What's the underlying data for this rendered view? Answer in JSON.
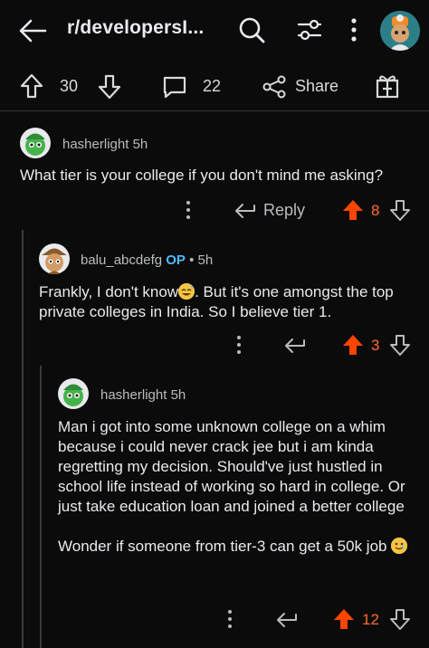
{
  "header": {
    "subreddit_title": "r/developersI...",
    "icons": [
      "back-arrow-icon",
      "search-icon",
      "sort-filter-icon",
      "more-vertical-icon",
      "subreddit-avatar-icon"
    ]
  },
  "post_actions": {
    "upvotes": "30",
    "comments": "22",
    "share_label": "Share"
  },
  "comments": [
    {
      "username": "hasherlight",
      "op_badge": "",
      "time": "5h",
      "body": [
        "What tier is your college if you don't mind me asking?"
      ],
      "reply_label": "Reply",
      "votes": "8"
    },
    {
      "username": "balu_abcdefg",
      "op_badge": "OP",
      "time": "5h",
      "body_prefix": "Frankly, I don't know",
      "body_suffix": ". But it's one amongst the top private colleges in India. So I believe tier 1.",
      "emoji": "sweat-smile-emoji",
      "votes": "3"
    },
    {
      "username": "hasherlight",
      "op_badge": "",
      "time": "5h",
      "body": [
        "Man i got into some unknown college on a whim because i could never crack jee but i am kinda regretting my decision. Should've just hustled in school life instead of working so hard in college. Or just take education loan and joined a better college"
      ],
      "body2_prefix": "Wonder if someone from tier-3 can get a 50k job",
      "emoji": "tear-smile-emoji",
      "votes": "12"
    }
  ],
  "colors": {
    "background": "#0b0b0b",
    "text": "#e8eaed",
    "muted": "#b9bcbe",
    "upvote_active": "#ff4500",
    "op_badge": "#4fbcff"
  }
}
